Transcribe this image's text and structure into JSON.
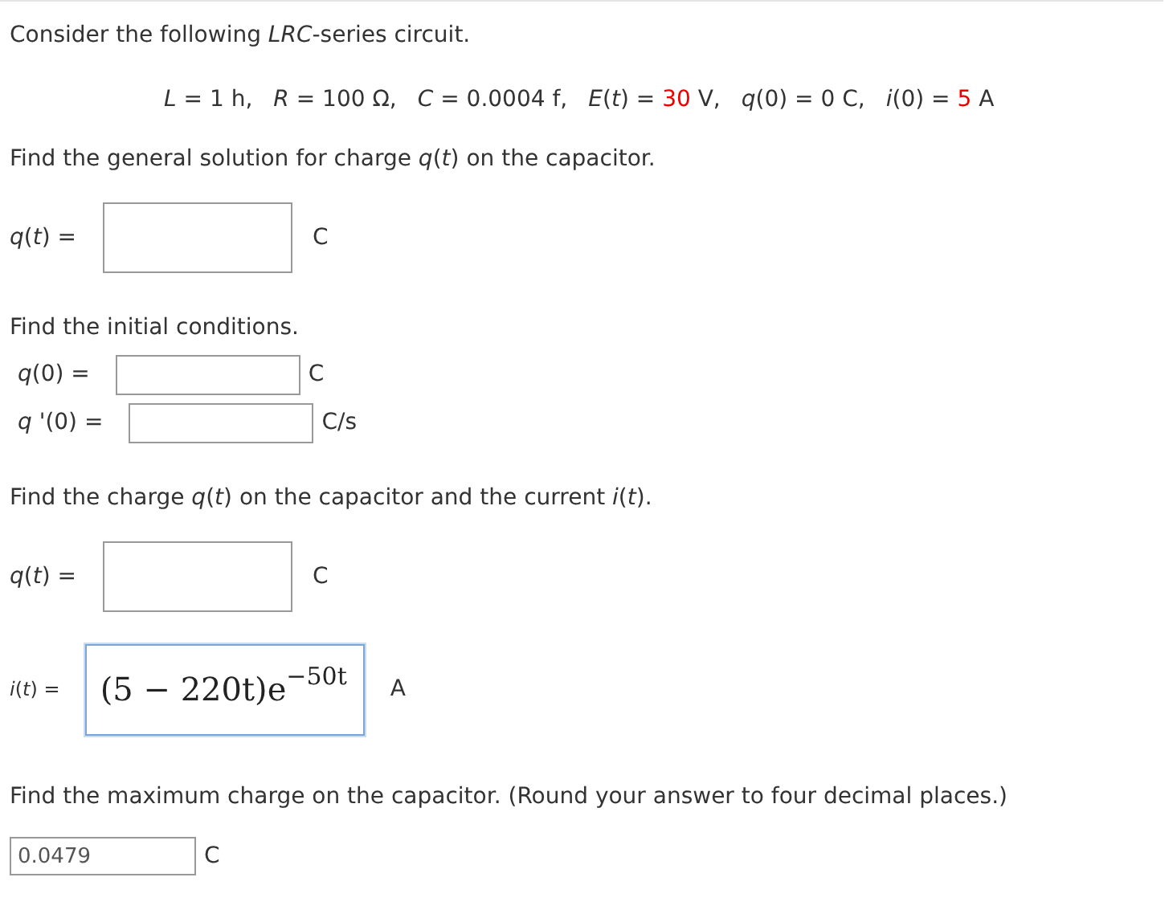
{
  "intro": "Consider the following *LRC*-series circuit.",
  "params": [
    {
      "name": "*L* =",
      "value": "1",
      "unit": "h,",
      "highlighted": false
    },
    {
      "name": "*R* =",
      "value": "100",
      "unit": "Ω,",
      "highlighted": false
    },
    {
      "name": "*C* =",
      "value": "0.0004",
      "unit": "f,",
      "highlighted": false
    },
    {
      "name": "*E*(*t*) =",
      "value": "30",
      "unit": "V,",
      "highlighted": true
    },
    {
      "name": "*q*(0) =",
      "value": "0",
      "unit": "C,",
      "highlighted": false
    },
    {
      "name": "*i*(0) =",
      "value": "5",
      "unit": "A",
      "highlighted": true
    }
  ],
  "sections": [
    {
      "prompt": "Find the general solution for charge *q*(*t*) on the capacitor.",
      "fields": [
        {
          "kind": "large",
          "label": "*q*(*t*) =",
          "unit": "C"
        }
      ]
    },
    {
      "prompt": "Find the initial conditions.",
      "fields": [
        {
          "kind": "small",
          "label": "*q*(0) =",
          "unit": "C"
        },
        {
          "kind": "small",
          "label": "*q* '(0) =",
          "unit": "C/s"
        }
      ]
    },
    {
      "prompt": "Find the charge *q*(*t*) on the capacitor and the current *i*(*t*).",
      "fields": [
        {
          "kind": "large",
          "label": "*q*(*t*) =",
          "unit": "C"
        },
        {
          "kind": "math",
          "label": "*i*(*t*) =",
          "value": "(5 − 220t)e$^{−50t}$",
          "unit": "A",
          "focused": true
        }
      ]
    },
    {
      "prompt": "Find the maximum charge on the capacitor. (Round your answer to four decimal places.)",
      "fields": [
        {
          "kind": "plain",
          "value": "0.0479",
          "unit": "C"
        }
      ]
    }
  ]
}
